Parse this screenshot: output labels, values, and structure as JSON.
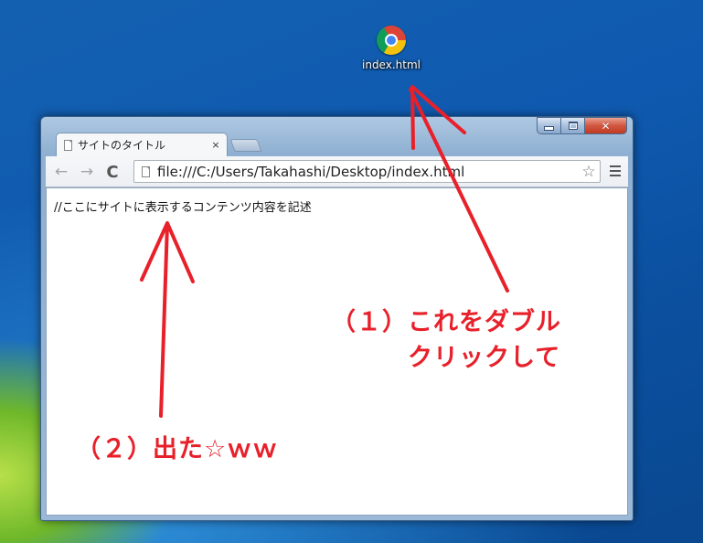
{
  "desktop": {
    "icon_label": "index.html"
  },
  "window": {
    "controls": {
      "minimize": "",
      "maximize": "",
      "close": "✕"
    }
  },
  "browser": {
    "tab_title": "サイトのタイトル",
    "tab_close": "×",
    "nav": {
      "back": "←",
      "forward": "→",
      "reload": "C"
    },
    "url": "file:///C:/Users/Takahashi/Desktop/index.html",
    "star": "☆"
  },
  "page": {
    "text": "//ここにサイトに表示するコンテンツ内容を記述"
  },
  "annotations": {
    "step1": "（１）これをダブル\n　　　クリックして",
    "step2": "（２）出た☆ｗｗ"
  },
  "colors": {
    "annotation": "#e8202a",
    "desktop_blue": "#0f5ab0"
  }
}
